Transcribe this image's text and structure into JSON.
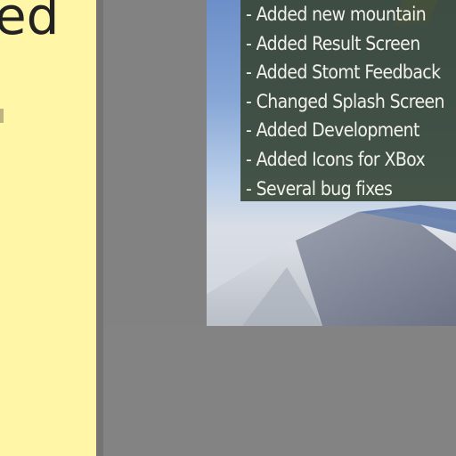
{
  "sticky_note": {
    "text": "ed",
    "color": "#fff6a8"
  },
  "changelog": {
    "items": [
      "- Added new mountain",
      "- Added Result Screen",
      "- Added Stomt Feedback",
      "- Changed Splash Screen",
      "- Added Development",
      "- Added Icons for XBox",
      "- Several bug fixes"
    ]
  },
  "colors": {
    "background": "#828282",
    "panel": "#3a4838",
    "panel_text": "#f2f2ea",
    "sky": "#86a6d6"
  }
}
